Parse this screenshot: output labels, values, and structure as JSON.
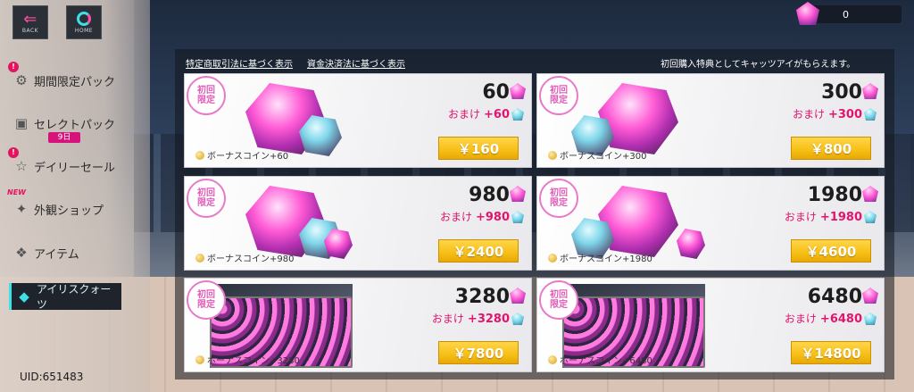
{
  "nav": {
    "back_label": "BACK",
    "home_label": "HOME"
  },
  "currency": {
    "value": "0",
    "icon": "gem-icon"
  },
  "menu": {
    "items": [
      {
        "label": "期間限定パック",
        "badge": "!"
      },
      {
        "label": "セレクトパック",
        "days": "9日"
      },
      {
        "label": "デイリーセール",
        "badge": "!"
      },
      {
        "label": "外観ショップ",
        "badge": "NEW"
      },
      {
        "label": "アイテム"
      },
      {
        "label": "アイリスクォーツ",
        "active": true
      }
    ]
  },
  "uid": "UID:651483",
  "legal": {
    "link1": "特定商取引法に基づく表示",
    "link2": "資金決済法に基づく表示"
  },
  "notice": "初回購入特典としてキャッツアイがもらえます。",
  "packs": [
    {
      "badge": "初回\n限定",
      "amount": "60",
      "bonus_label": "おまけ",
      "bonus": "+60",
      "coin": "ボーナスコイン+60",
      "price": "￥160"
    },
    {
      "badge": "初回\n限定",
      "amount": "300",
      "bonus_label": "おまけ",
      "bonus": "+300",
      "coin": "ボーナスコイン+300",
      "price": "￥800"
    },
    {
      "badge": "初回\n限定",
      "amount": "980",
      "bonus_label": "おまけ",
      "bonus": "+980",
      "coin": "ボーナスコイン+980",
      "price": "￥2400"
    },
    {
      "badge": "初回\n限定",
      "amount": "1980",
      "bonus_label": "おまけ",
      "bonus": "+1980",
      "coin": "ボーナスコイン+1980",
      "price": "￥4600"
    },
    {
      "badge": "初回\n限定",
      "amount": "3280",
      "bonus_label": "おまけ",
      "bonus": "+3280",
      "coin": "ボーナスコイン+3280",
      "price": "￥7800"
    },
    {
      "badge": "初回\n限定",
      "amount": "6480",
      "bonus_label": "おまけ",
      "bonus": "+6480",
      "coin": "ボーナスコイン+6480",
      "price": "￥14800"
    }
  ],
  "colors": {
    "accent_pink": "#e2146e",
    "price_yellow": "#f6bf14",
    "active_cyan": "#3ee0e8"
  }
}
